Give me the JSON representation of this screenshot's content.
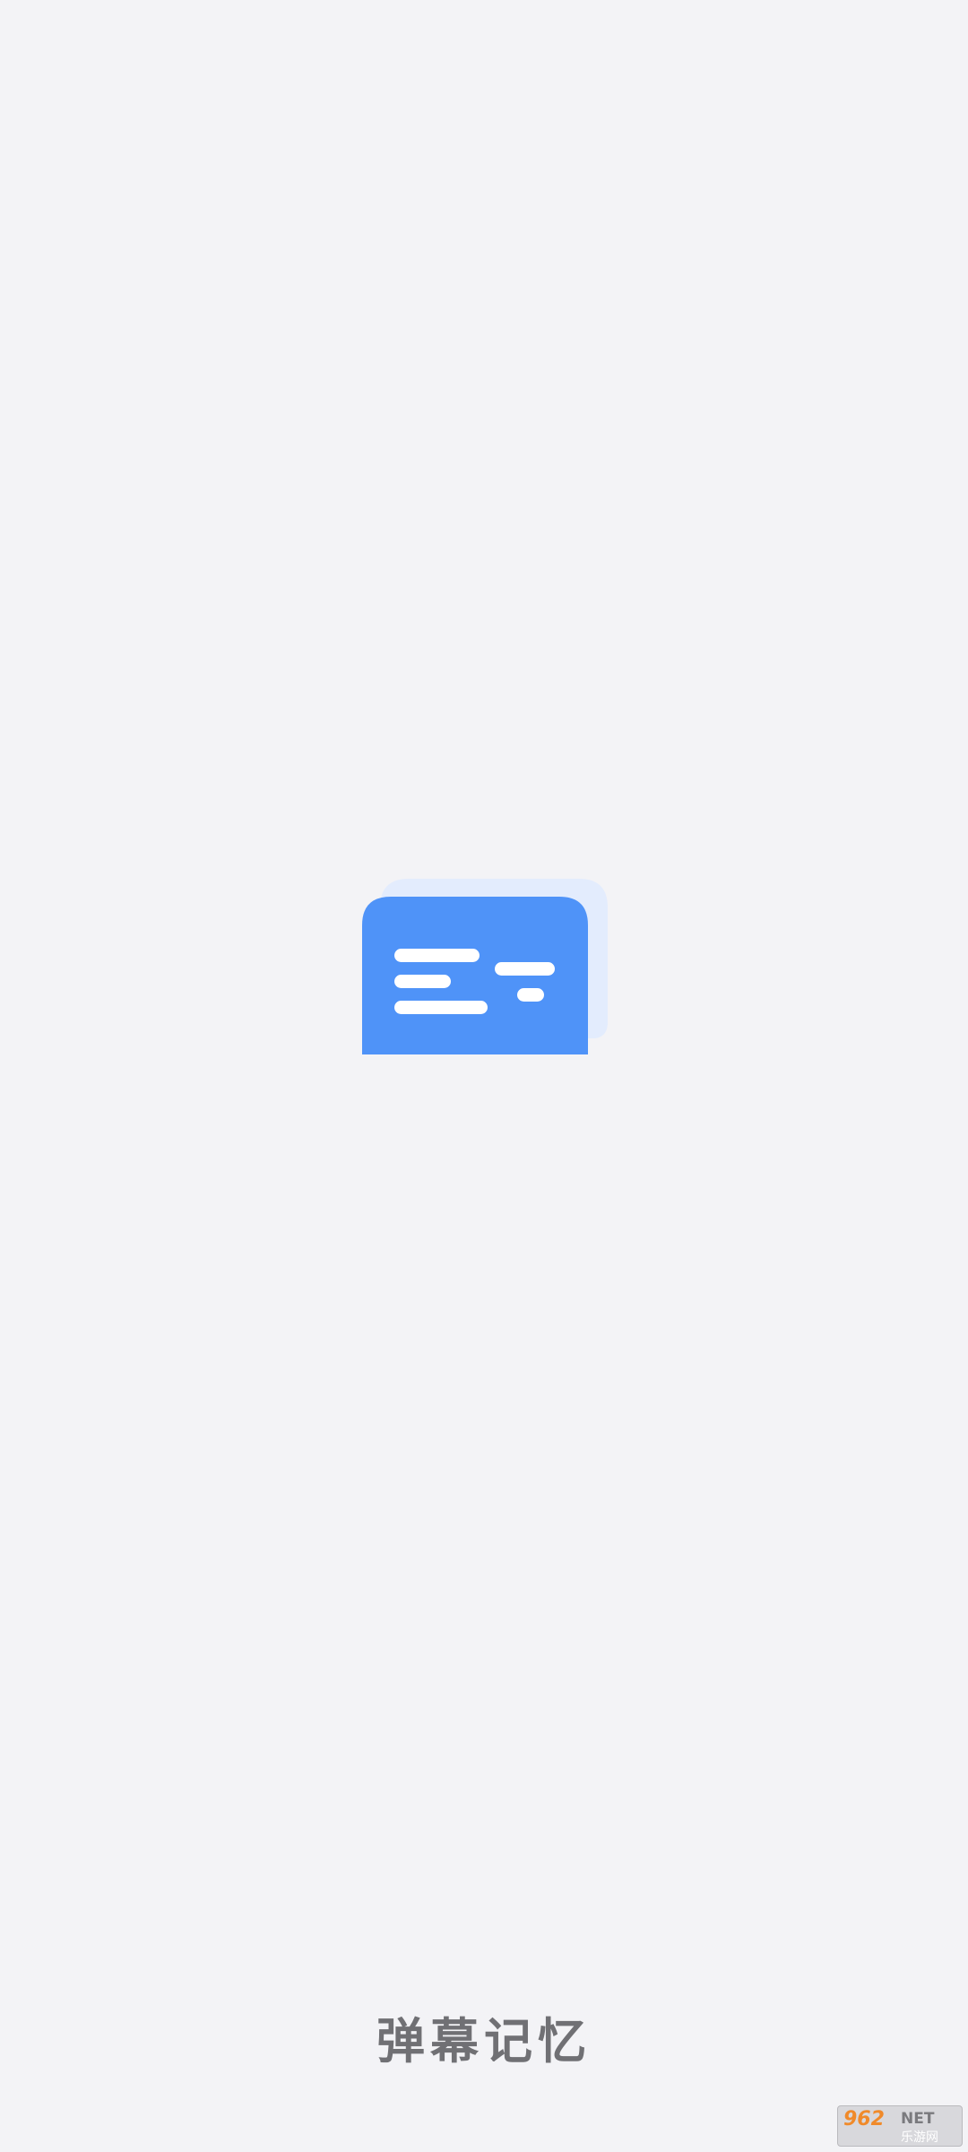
{
  "app_name": "弹幕记忆",
  "colors": {
    "background": "#f3f3f6",
    "logo_primary": "#4f93f8",
    "logo_shadow": "#e3ecfd",
    "logo_bars": "#ffffff",
    "app_name_text": "#707074"
  },
  "icons": {
    "logo": "danmaku-chat-bubble-icon"
  },
  "watermark": {
    "number": "962",
    "suffix": "NET",
    "site": "乐游网"
  }
}
